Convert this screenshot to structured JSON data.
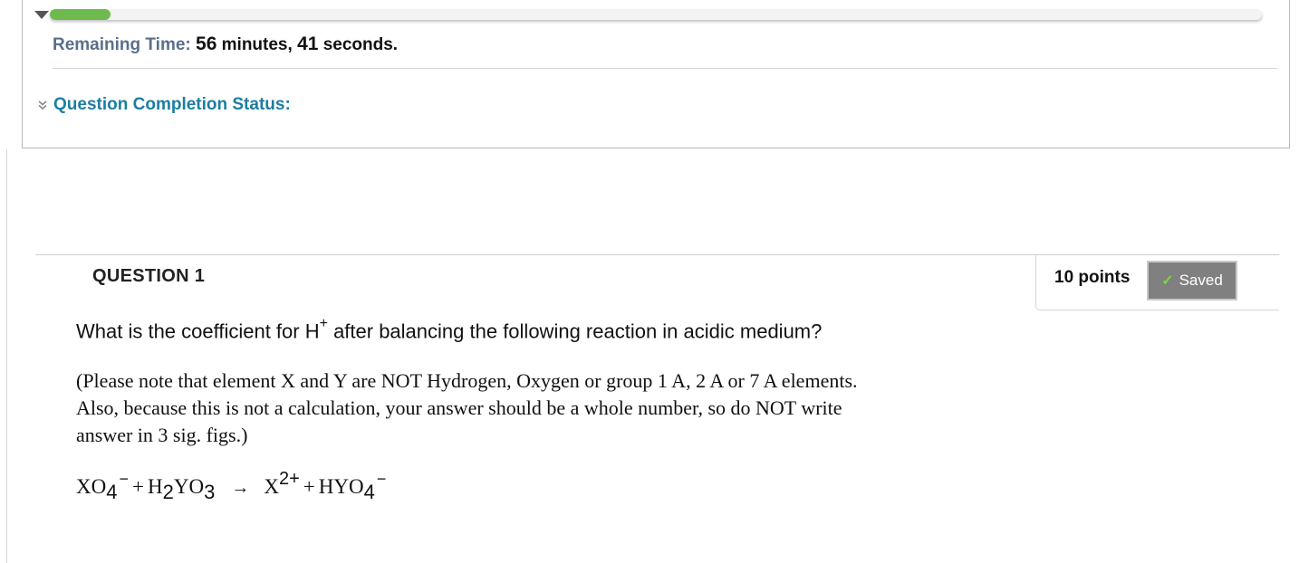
{
  "timer": {
    "progress": 0.05,
    "label": "Remaining Time:",
    "minutes": "56",
    "minutes_unit": "minutes,",
    "seconds": "41",
    "seconds_unit": "seconds."
  },
  "completion_status": {
    "label": "Question Completion Status:"
  },
  "question": {
    "title": "QUESTION 1",
    "points": "10 points",
    "saved_label": "Saved",
    "prompt_before": "What is the coefficient for H",
    "prompt_sup": "+",
    "prompt_after": " after balancing the following reaction in acidic medium?",
    "note_lines": [
      "(Please note that element X and Y are NOT Hydrogen, Oxygen or group 1 A, 2 A or 7 A elements.",
      "Also, because this is not a calculation, your answer should be a whole number, so do NOT write",
      "answer in 3 sig. figs.)"
    ],
    "equation": {
      "t1": "XO",
      "t1_sub": "4",
      "t1_sup": "−",
      "plus1": "+",
      "t2a": "H",
      "t2_sub1": "2",
      "t2b": "YO",
      "t2_sub2": "3",
      "arrow": "→",
      "t3": "X",
      "t3_sup": "2+",
      "plus2": "+",
      "t4": "HYO",
      "t4_sub": "4",
      "t4_sup": "−"
    }
  },
  "colors": {
    "progress_fill": "#6dbb4f",
    "time_label": "#5b6f8a",
    "status_link": "#1c7ea0",
    "saved_badge": "#808080",
    "saved_check": "#7cd34a"
  },
  "icons": [
    "collapse-triangle-icon",
    "double-chevron-down-icon",
    "checkmark-icon"
  ]
}
